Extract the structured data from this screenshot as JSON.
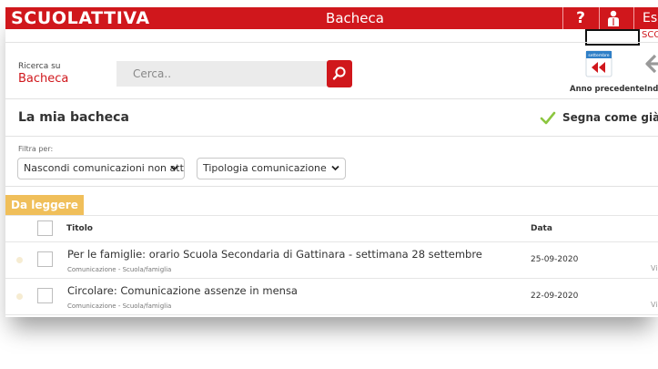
{
  "header": {
    "logo": "SCUOLATTIVA",
    "app_title": "Bacheca",
    "help": "?",
    "exit_label": "Es",
    "school_code_label": "SCO"
  },
  "search": {
    "label": "Ricerca su",
    "scope": "Bacheca",
    "placeholder": "Cerca.."
  },
  "toolbar": {
    "prev_year_label": "Anno precedente",
    "calendar_month": "settembre",
    "back_label": "Indi"
  },
  "board": {
    "title": "La mia bacheca",
    "mark_read_label": "Segna come già le"
  },
  "filters": {
    "label": "Filtra per:",
    "active_filter": "Nascondi comunicazioni non attive",
    "type_filter": "Tipologia comunicazione"
  },
  "tab": {
    "label": "Da leggere"
  },
  "table": {
    "columns": {
      "title": "Titolo",
      "date": "Data"
    },
    "rows": [
      {
        "title": "Per le famiglie: orario Scuola Secondaria di Gattinara - settimana 28 settembre",
        "subtitle": "Comunicazione - Scuola/famiglia",
        "date": "25-09-2020",
        "vis": "Vi"
      },
      {
        "title": "Circolare: Comunicazione assenze in mensa",
        "subtitle": "Comunicazione - Scuola/famiglia",
        "date": "22-09-2020",
        "vis": "Vi"
      }
    ]
  },
  "colors": {
    "brand_red": "#d0171c",
    "tab_yellow": "#f0bf5a",
    "check_green": "#8cc63f"
  }
}
